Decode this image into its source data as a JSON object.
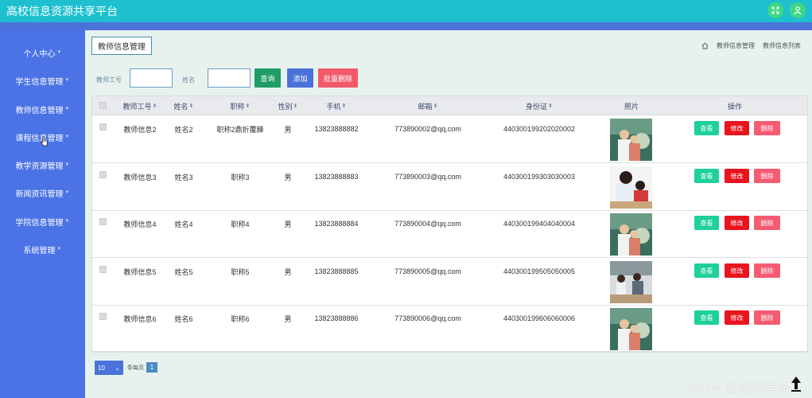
{
  "header": {
    "title": "高校信息资源共享平台"
  },
  "sidebar": {
    "items": [
      {
        "label": "个人中心"
      },
      {
        "label": "学生信息管理"
      },
      {
        "label": "教师信息管理"
      },
      {
        "label": "课程信息管理"
      },
      {
        "label": "教学资源管理"
      },
      {
        "label": "新闻资讯管理"
      },
      {
        "label": "学院信息管理"
      },
      {
        "label": "系统管理"
      }
    ]
  },
  "page": {
    "section_title": "教师信息管理",
    "breadcrumb": [
      "教师信息管理",
      "教师信息列表"
    ]
  },
  "search": {
    "id_label": "教师工号",
    "name_label": "姓名",
    "id_value": "",
    "name_value": "",
    "query_label": "查询",
    "add_label": "添加",
    "batch_delete_label": "批量删除"
  },
  "table": {
    "columns": [
      "教师工号",
      "姓名",
      "职称",
      "性别",
      "手机",
      "邮箱",
      "身份证",
      "照片",
      "操作"
    ],
    "rows": [
      {
        "id": "教师信息2",
        "name": "姓名2",
        "title": "职称2鼎折覆餗",
        "gender": "男",
        "phone": "13823888882",
        "email": "773890002@qq.com",
        "idcard": "440300199202020002"
      },
      {
        "id": "教师信息3",
        "name": "姓名3",
        "title": "职称3",
        "gender": "男",
        "phone": "13823888883",
        "email": "773890003@qq.com",
        "idcard": "440300199303030003"
      },
      {
        "id": "教师信息4",
        "name": "姓名4",
        "title": "职称4",
        "gender": "男",
        "phone": "13823888884",
        "email": "773890004@qq.com",
        "idcard": "440300199404040004"
      },
      {
        "id": "教师信息5",
        "name": "姓名5",
        "title": "职称5",
        "gender": "男",
        "phone": "13823888885",
        "email": "773890005@qq.com",
        "idcard": "440300199505050005"
      },
      {
        "id": "教师信息6",
        "name": "姓名6",
        "title": "职称6",
        "gender": "男",
        "phone": "13823888886",
        "email": "773890006@qq.com",
        "idcard": "440300199606060006"
      }
    ],
    "actions": {
      "view": "查看",
      "edit": "修改",
      "delete": "删除"
    }
  },
  "pagination": {
    "page_size": "10",
    "per_page_label": "条每页",
    "current_page": "1"
  },
  "watermark": "CSDN @纳米学长",
  "colors": {
    "topbar": "#1ec0cf",
    "sidebar": "#4b73e5",
    "query": "#1e9d67",
    "add": "#4a72d9",
    "batch_delete": "#f25a6a",
    "view": "#1fd09a",
    "edit": "#e8141e",
    "delete": "#f55b71"
  }
}
